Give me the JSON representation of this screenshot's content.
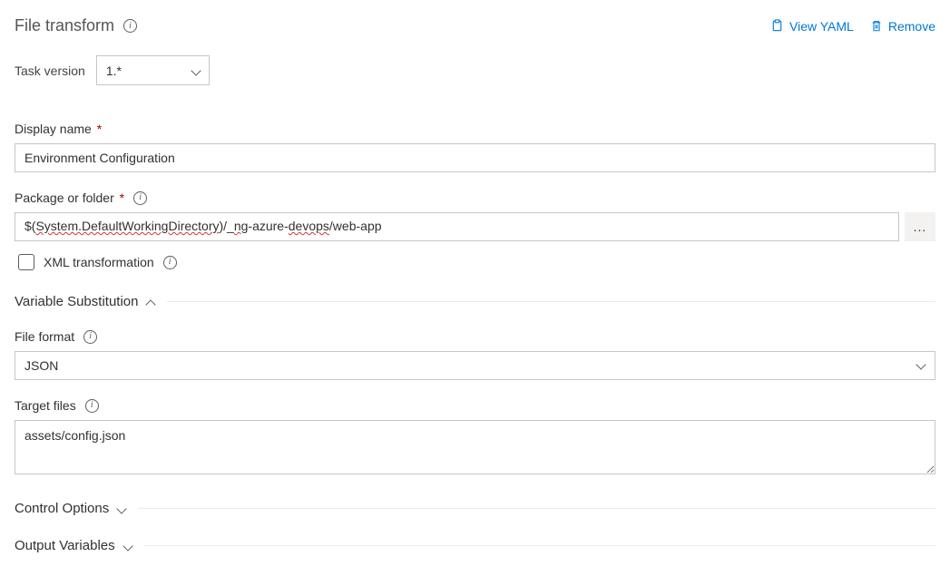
{
  "header": {
    "title": "File transform",
    "viewYamlLabel": "View YAML",
    "removeLabel": "Remove"
  },
  "taskVersion": {
    "label": "Task version",
    "value": "1.*"
  },
  "displayName": {
    "label": "Display name",
    "value": "Environment Configuration"
  },
  "packageFolder": {
    "label": "Package or folder",
    "value": "$(System.DefaultWorkingDirectory)/_ng-azure-devops/web-app",
    "moreBtn": "..."
  },
  "xmlTransform": {
    "label": "XML transformation",
    "checked": false
  },
  "sections": {
    "variableSubstitution": "Variable Substitution",
    "controlOptions": "Control Options",
    "outputVariables": "Output Variables"
  },
  "fileFormat": {
    "label": "File format",
    "value": "JSON"
  },
  "targetFiles": {
    "label": "Target files",
    "value": "assets/config.json"
  }
}
